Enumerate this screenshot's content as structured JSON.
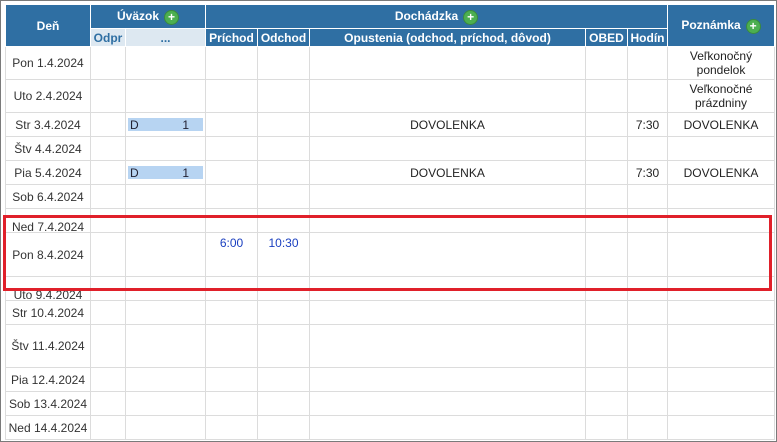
{
  "header": {
    "den": "Deň",
    "uvazok": "Úväzok",
    "dochadzka": "Dochádzka",
    "poznamka": "Poznámka",
    "odpr": "Odpr",
    "dots": "...",
    "prichod": "Príchod",
    "odchod": "Odchod",
    "opustenia": "Opustenia (odchod, príchod, dôvod)",
    "obed": "OBED",
    "hodin": "Hodín",
    "plus": "+"
  },
  "rows": [
    {
      "day": "Pon 1.4.2024",
      "note": "Veľkonočný pondelok"
    },
    {
      "day": "Uto 2.4.2024",
      "note": "Veľkonočné prázdniny"
    },
    {
      "day": "Str 3.4.2024",
      "uv_code": "D",
      "uv_val": "1",
      "opustenia": "DOVOLENKA",
      "hodin": "7:30",
      "note": "DOVOLENKA"
    },
    {
      "day": "Štv 4.4.2024"
    },
    {
      "day": "Pia 5.4.2024",
      "uv_code": "D",
      "uv_val": "1",
      "opustenia": "DOVOLENKA",
      "hodin": "7:30",
      "note": "DOVOLENKA"
    },
    {
      "day": "Sob 6.4.2024"
    },
    {
      "day": "Ned 7.4.2024"
    },
    {
      "day": "Pon 8.4.2024",
      "prichod": "6:00",
      "odchod": "10:30"
    },
    {
      "day": "Uto 9.4.2024"
    },
    {
      "day": "Str 10.4.2024"
    },
    {
      "day": "Štv 11.4.2024"
    },
    {
      "day": "Pia 12.4.2024"
    },
    {
      "day": "Sob 13.4.2024"
    },
    {
      "day": "Ned 14.4.2024"
    }
  ]
}
